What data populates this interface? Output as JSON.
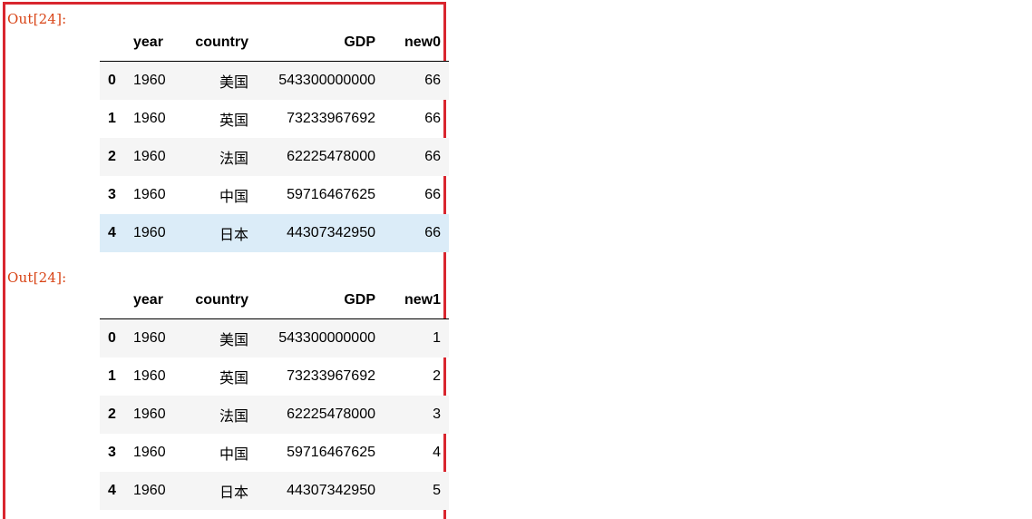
{
  "outputs": [
    {
      "prompt": "Out[24]:",
      "columns": [
        "year",
        "country",
        "GDP",
        "new0"
      ],
      "rows": [
        {
          "index": "0",
          "year": "1960",
          "country": "美国",
          "gdp": "543300000000",
          "new": "66"
        },
        {
          "index": "1",
          "year": "1960",
          "country": "英国",
          "gdp": "73233967692",
          "new": "66"
        },
        {
          "index": "2",
          "year": "1960",
          "country": "法国",
          "gdp": "62225478000",
          "new": "66"
        },
        {
          "index": "3",
          "year": "1960",
          "country": "中国",
          "gdp": "59716467625",
          "new": "66"
        },
        {
          "index": "4",
          "year": "1960",
          "country": "日本",
          "gdp": "44307342950",
          "new": "66"
        }
      ]
    },
    {
      "prompt": "Out[24]:",
      "columns": [
        "year",
        "country",
        "GDP",
        "new1"
      ],
      "rows": [
        {
          "index": "0",
          "year": "1960",
          "country": "美国",
          "gdp": "543300000000",
          "new": "1"
        },
        {
          "index": "1",
          "year": "1960",
          "country": "英国",
          "gdp": "73233967692",
          "new": "2"
        },
        {
          "index": "2",
          "year": "1960",
          "country": "法国",
          "gdp": "62225478000",
          "new": "3"
        },
        {
          "index": "3",
          "year": "1960",
          "country": "中国",
          "gdp": "59716467625",
          "new": "4"
        },
        {
          "index": "4",
          "year": "1960",
          "country": "日本",
          "gdp": "44307342950",
          "new": "5"
        }
      ]
    }
  ],
  "colors": {
    "highlight_border": "#d9262f",
    "prompt_text": "#d84315",
    "striped_row": "#f5f5f5",
    "hovered_row": "#dbecf8"
  }
}
